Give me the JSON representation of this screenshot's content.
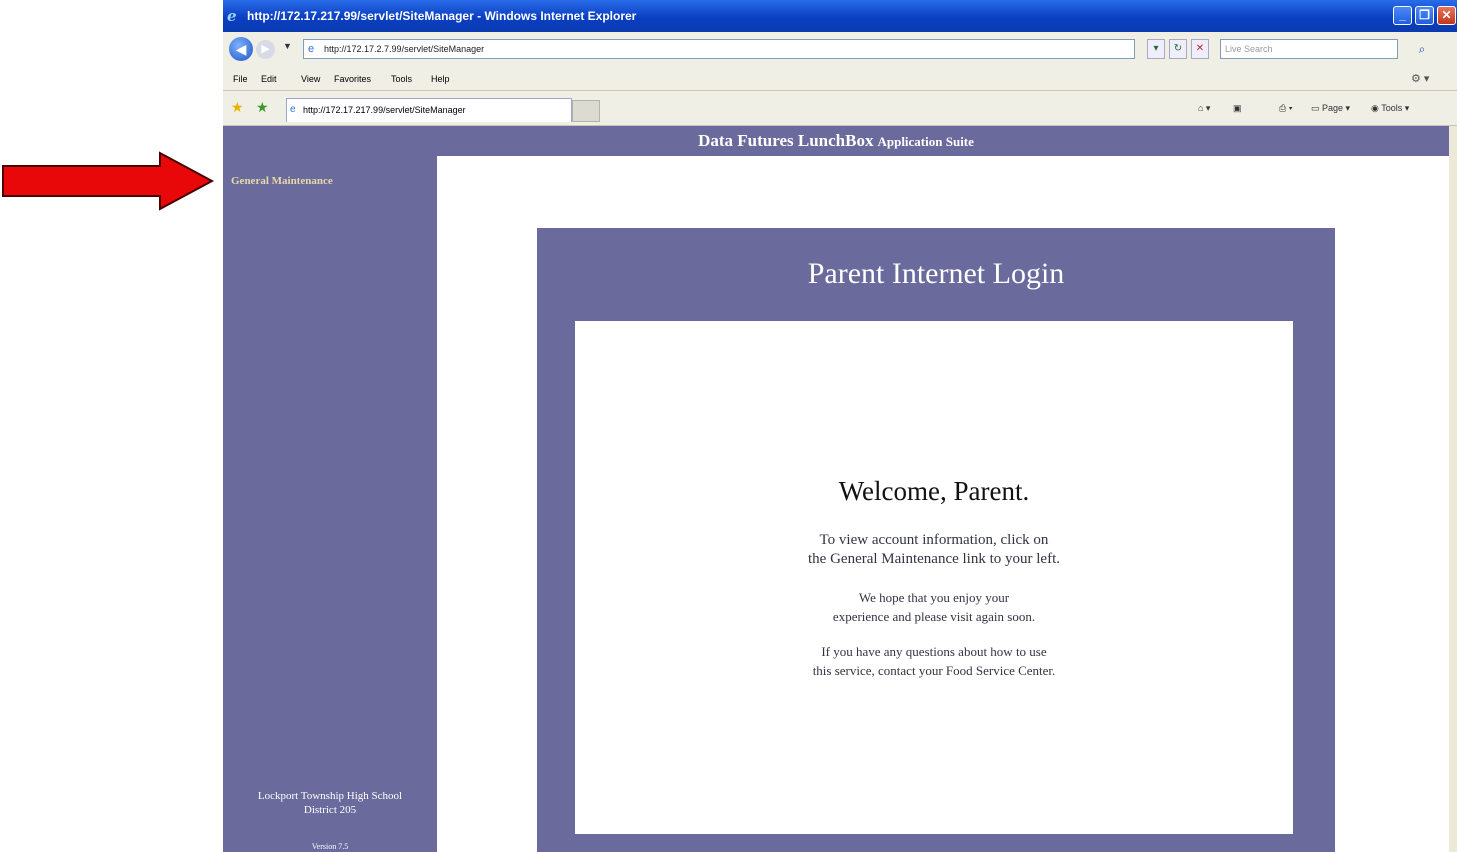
{
  "browser": {
    "title": "http://172.17.217.99/servlet/SiteManager - Windows Internet Explorer",
    "address": "http://172.17.2.7.99/servlet/SiteManager",
    "search_placeholder": "Live Search",
    "menu": [
      "File",
      "Edit",
      "View",
      "Favorites",
      "Tools",
      "Help"
    ],
    "tab_label": "http://172.17.217.99/servlet/SiteManager",
    "commands": {
      "page": "Page",
      "tools": "Tools"
    }
  },
  "app": {
    "header_main": "Data Futures LunchBox",
    "header_sub": "Application Suite"
  },
  "sidebar": {
    "link": "General Maintenance",
    "school_line1": "Lockport Township High School",
    "school_line2": "District 205",
    "version": "Version 7.5"
  },
  "login": {
    "title": "Parent Internet Login",
    "welcome": "Welcome, Parent.",
    "p1_line1": "To view account information, click on",
    "p1_line2": "the General Maintenance link to your left.",
    "p2_line1": "We hope that you enjoy your",
    "p2_line2": "experience and please visit again soon.",
    "p3_line1": "If you have any questions about how to use",
    "p3_line2": "this service, contact your Food Service Center."
  },
  "colors": {
    "arrow": "#e8080a",
    "app_purple": "#6a6a9c",
    "link_gold": "#e4d9a8"
  }
}
